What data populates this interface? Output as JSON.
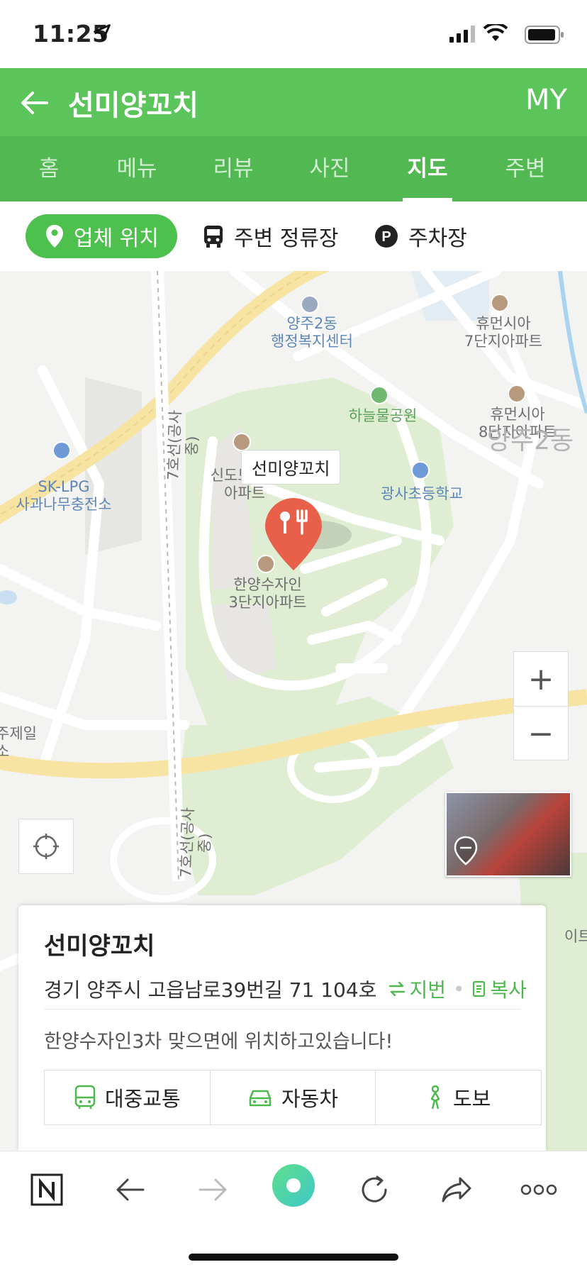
{
  "status_bar": {
    "time": "11:25"
  },
  "header": {
    "title": "선미양꼬치",
    "my_label": "MY"
  },
  "tabs": [
    {
      "label": "홈",
      "active": false
    },
    {
      "label": "메뉴",
      "active": false
    },
    {
      "label": "리뷰",
      "active": false
    },
    {
      "label": "사진",
      "active": false
    },
    {
      "label": "지도",
      "active": true
    },
    {
      "label": "주변",
      "active": false
    }
  ],
  "filters": [
    {
      "label": "업체 위치",
      "icon": "pin-icon",
      "active": true
    },
    {
      "label": "주변 정류장",
      "icon": "bus-icon",
      "active": false
    },
    {
      "label": "주차장",
      "icon": "parking-icon",
      "active": false
    }
  ],
  "map": {
    "callout": "선미양꼬치",
    "labels": {
      "yangju2": "양주2동\n행정복지센터",
      "hyumun7": "휴먼시아\n7단지아파트",
      "haneul": "하늘물공원",
      "hyumun8": "휴먼시아\n8단지아파트",
      "district": "양주2동",
      "sklpg": "SK-LPG\n사과나무충전소",
      "sindo": "신도브래뉴\n아파트",
      "gwangsa": "광사초등학교",
      "hanyang": "한양수자인\n3단지아파트",
      "road1": "7호선(공사중)",
      "road2": "7호선(공사중)",
      "edge_left": "주제일\n소",
      "edge_right": "이트"
    },
    "zoom_in": "+",
    "zoom_out": "−"
  },
  "place": {
    "name": "선미양꼬치",
    "address": "경기 양주시 고읍남로39번길 71 104호",
    "lot_label": "지번",
    "copy_label": "복사",
    "description": "한양수자인3차 맞으면에 위치하고있습니다!",
    "routes": [
      {
        "label": "대중교통",
        "icon": "bus-icon"
      },
      {
        "label": "자동차",
        "icon": "car-icon"
      },
      {
        "label": "도보",
        "icon": "walk-icon"
      }
    ]
  },
  "colors": {
    "accent": "#5bc55b",
    "marker": "#e9604a"
  }
}
